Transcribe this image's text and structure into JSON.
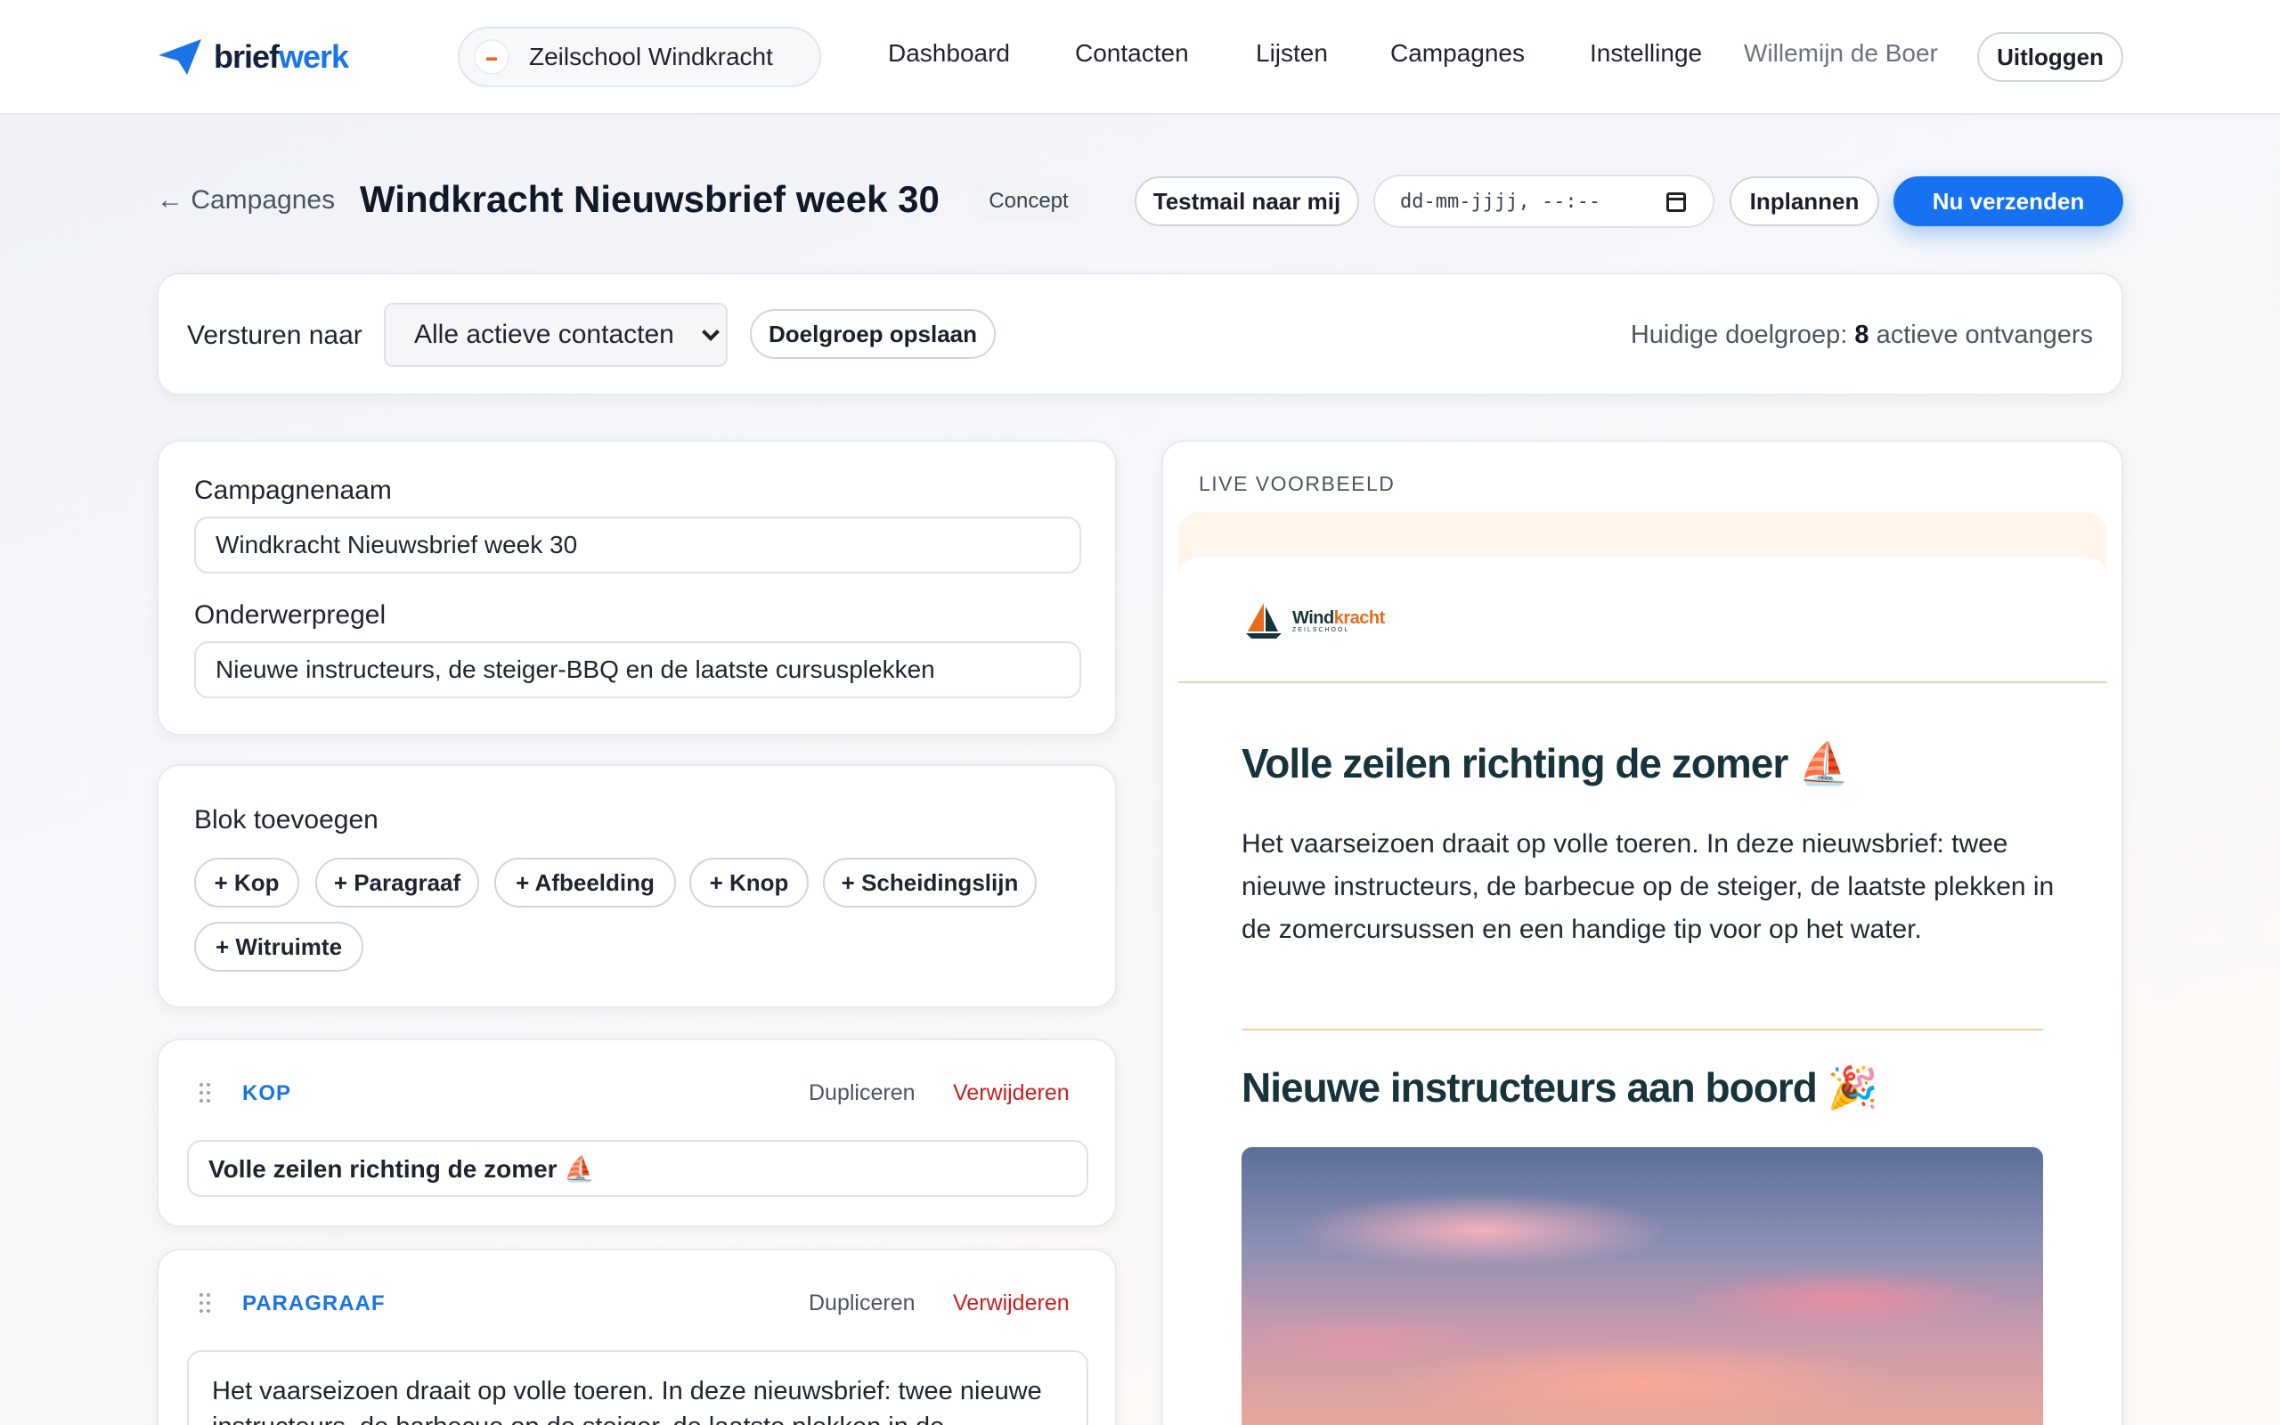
{
  "brand": {
    "part1": "brief",
    "part2": "werk",
    "accent": "#1a74e8"
  },
  "org": {
    "name": "Zeilschool Windkracht"
  },
  "nav": {
    "items": [
      "Dashboard",
      "Contacten",
      "Lijsten",
      "Campagnes",
      "Instellingen"
    ]
  },
  "user": {
    "name": "Willemijn de Boer",
    "logout_label": "Uitloggen"
  },
  "header": {
    "back_label": "← Campagnes",
    "title": "Windkracht Nieuwsbrief week 30",
    "status": "Concept",
    "testmail_label": "Testmail naar mij",
    "date_placeholder": "dd-mm-jjjj, --:--",
    "schedule_label": "Inplannen",
    "send_label": "Nu verzenden"
  },
  "audience": {
    "send_to_label": "Versturen naar",
    "selected": "Alle actieve contacten",
    "save_label": "Doelgroep opslaan",
    "current_prefix": "Huidige doelgroep:",
    "count": "8",
    "current_suffix": "actieve ontvangers"
  },
  "settings": {
    "name_label": "Campagnenaam",
    "name_value": "Windkracht Nieuwsbrief week 30",
    "subject_label": "Onderwerpregel",
    "subject_value": "Nieuwe instructeurs, de steiger-BBQ en de laatste cursusplekken"
  },
  "add_block": {
    "title": "Blok toevoegen",
    "chips": [
      "+ Kop",
      "+ Paragraaf",
      "+ Afbeelding",
      "+ Knop",
      "+ Scheidingslijn",
      "+ Witruimte"
    ]
  },
  "blocks": [
    {
      "type": "KOP",
      "duplicate": "Dupliceren",
      "delete": "Verwijderen",
      "content": "Volle zeilen richting de zomer ⛵"
    },
    {
      "type": "PARAGRAAF",
      "duplicate": "Dupliceren",
      "delete": "Verwijderen",
      "content": "Het vaarseizoen draait op volle toeren. In deze nieuwsbrief: twee nieuwe instructeurs, de barbecue op de steiger, de laatste plekken in de"
    }
  ],
  "preview": {
    "label": "LIVE VOORBEELD",
    "logo_word1": "Wind",
    "logo_word2": "kracht",
    "logo_sub": "ZEILSCHOOL",
    "heading1": "Volle zeilen richting de zomer ⛵",
    "paragraph": "Het vaarseizoen draait op volle toeren. In deze nieuwsbrief: twee nieuwe instructeurs, de barbecue op de steiger, de laatste plekken in de zomercursussen en een handige tip voor op het water.",
    "heading2": "Nieuwe instructeurs aan boord 🎉"
  },
  "colors": {
    "primary": "#1672f0",
    "danger": "#c81e1e",
    "email_heading": "#17343c",
    "email_accent": "#f4cfa6"
  }
}
